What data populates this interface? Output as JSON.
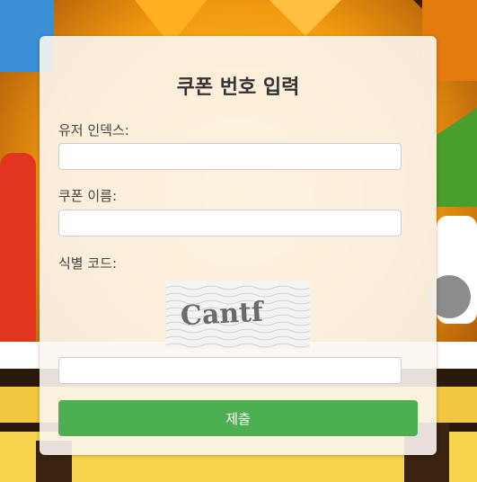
{
  "form": {
    "title": "쿠폰 번호 입력",
    "user_index_label": "유저 인덱스:",
    "user_index_value": "",
    "coupon_name_label": "쿠폰 이름:",
    "coupon_name_value": "",
    "id_code_label": "식별 코드:",
    "captcha_text": "Cantf",
    "captcha_value": "",
    "submit_label": "제출"
  },
  "colors": {
    "submit_button": "#4caf50",
    "card_background": "#fcf6f0",
    "title_text": "#333333"
  }
}
